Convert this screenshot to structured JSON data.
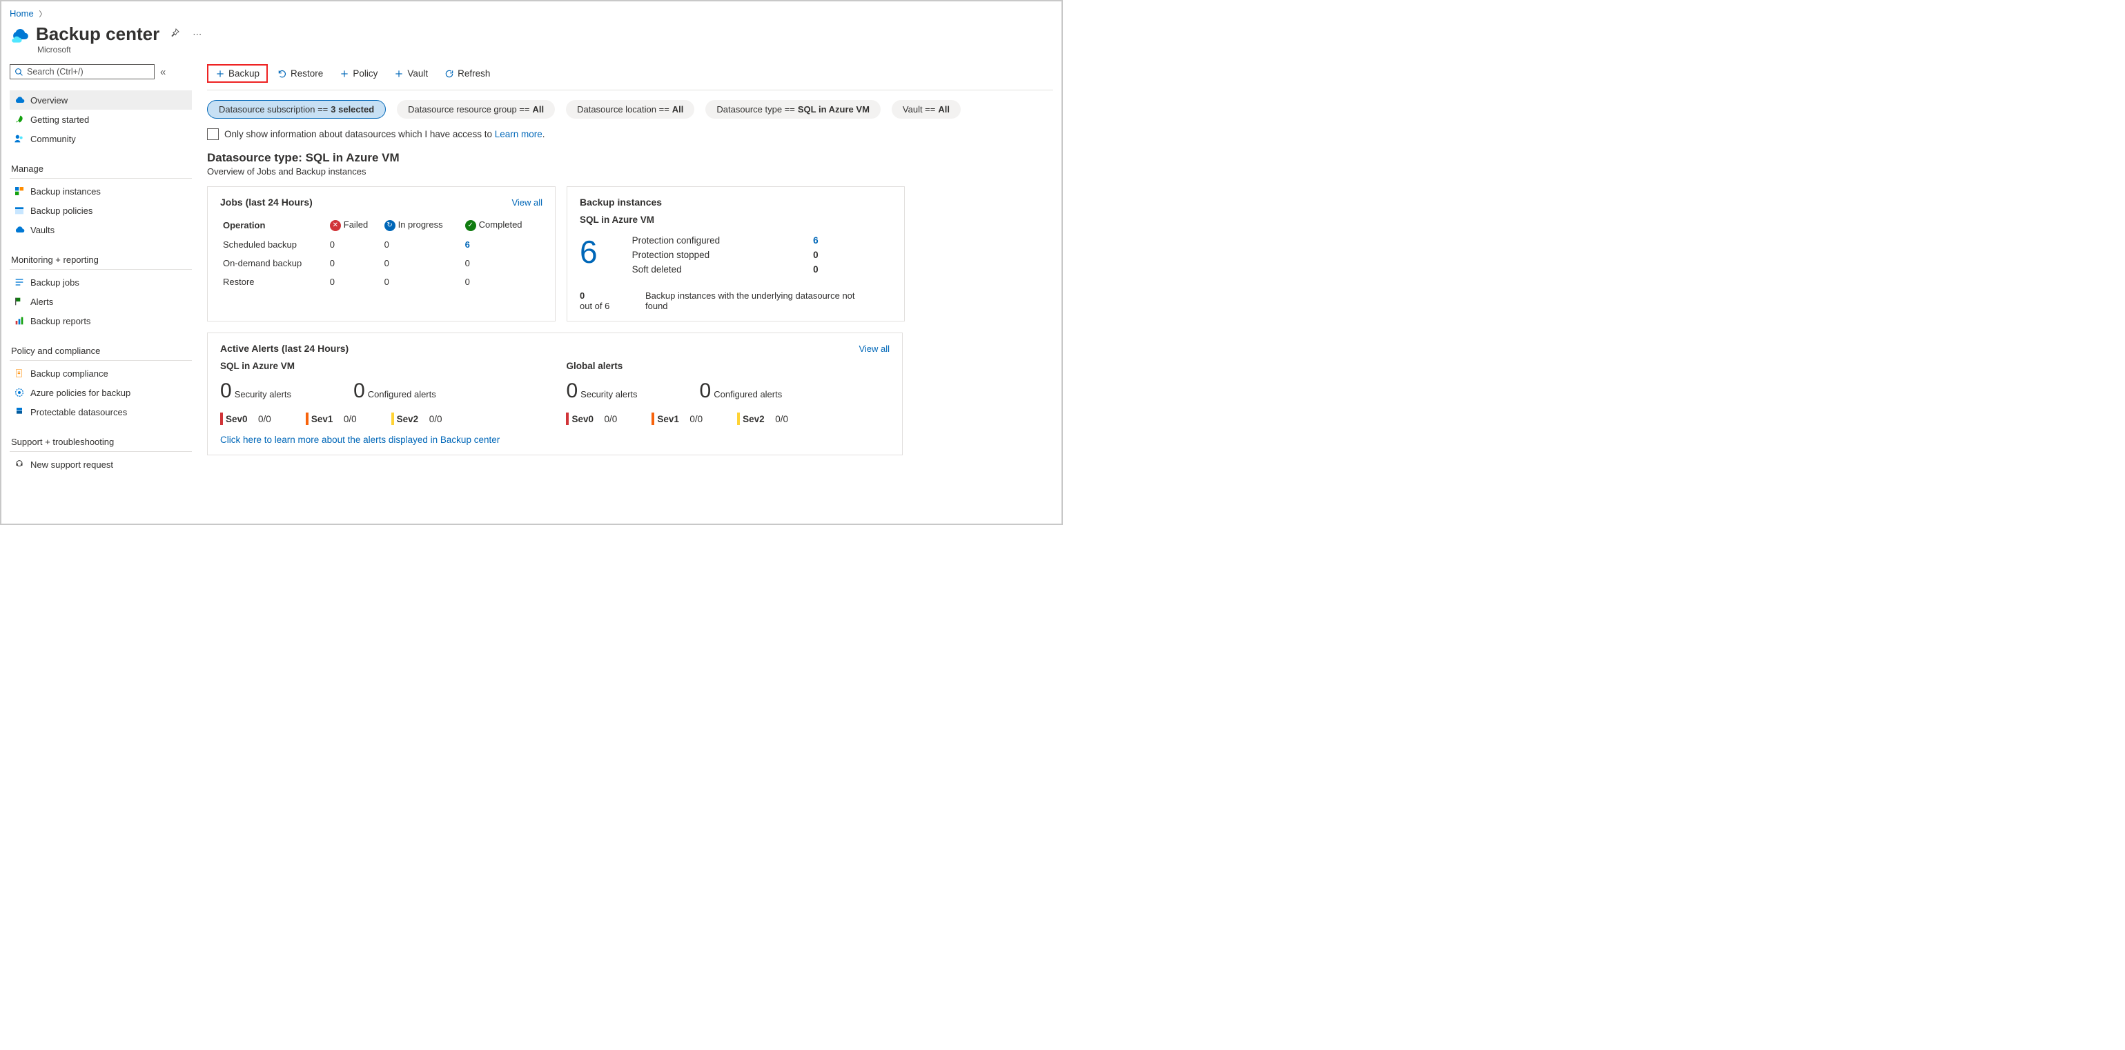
{
  "breadcrumb": {
    "home": "Home"
  },
  "header": {
    "title": "Backup center",
    "subtitle": "Microsoft"
  },
  "search": {
    "placeholder": "Search (Ctrl+/)"
  },
  "sidebar": {
    "s1": [
      {
        "label": "Overview"
      },
      {
        "label": "Getting started"
      },
      {
        "label": "Community"
      }
    ],
    "h2": "Manage",
    "s2": [
      {
        "label": "Backup instances"
      },
      {
        "label": "Backup policies"
      },
      {
        "label": "Vaults"
      }
    ],
    "h3": "Monitoring + reporting",
    "s3": [
      {
        "label": "Backup jobs"
      },
      {
        "label": "Alerts"
      },
      {
        "label": "Backup reports"
      }
    ],
    "h4": "Policy and compliance",
    "s4": [
      {
        "label": "Backup compliance"
      },
      {
        "label": "Azure policies for backup"
      },
      {
        "label": "Protectable datasources"
      }
    ],
    "h5": "Support + troubleshooting",
    "s5": [
      {
        "label": "New support request"
      }
    ]
  },
  "toolbar": {
    "backup": "Backup",
    "restore": "Restore",
    "policy": "Policy",
    "vault": "Vault",
    "refresh": "Refresh"
  },
  "pills": {
    "p1_label": "Datasource subscription == ",
    "p1_val": "3 selected",
    "p2_label": "Datasource resource group == ",
    "p2_val": "All",
    "p3_label": "Datasource location == ",
    "p3_val": "All",
    "p4_label": "Datasource type == ",
    "p4_val": "SQL in Azure VM",
    "p5_label": "Vault == ",
    "p5_val": "All"
  },
  "checkbox_row": {
    "label": "Only show information about datasources which I have access to ",
    "link": "Learn more"
  },
  "dstype": {
    "title": "Datasource type: SQL in Azure VM",
    "sub": "Overview of Jobs and Backup instances"
  },
  "jobs_card": {
    "title": "Jobs (last 24 Hours)",
    "viewall": "View all",
    "col_op": "Operation",
    "col_failed": "Failed",
    "col_prog": "In progress",
    "col_comp": "Completed",
    "r1": "Scheduled backup",
    "r1f": "0",
    "r1p": "0",
    "r1c": "6",
    "r2": "On-demand backup",
    "r2f": "0",
    "r2p": "0",
    "r2c": "0",
    "r3": "Restore",
    "r3f": "0",
    "r3p": "0",
    "r3c": "0"
  },
  "inst_card": {
    "title": "Backup instances",
    "sub": "SQL in Azure VM",
    "big": "6",
    "m1": "Protection configured",
    "v1": "6",
    "m2": "Protection stopped",
    "v2": "0",
    "m3": "Soft deleted",
    "v3": "0",
    "bot_n": "0",
    "bot_t": "out of 6",
    "bot_msg": "Backup instances with the underlying datasource not found"
  },
  "alerts_card": {
    "title": "Active Alerts (last 24 Hours)",
    "viewall": "View all",
    "sec1": "SQL in Azure VM",
    "sec2": "Global alerts",
    "security": "Security alerts",
    "configured": "Configured alerts",
    "zero": "0",
    "sev0": "Sev0",
    "sev1": "Sev1",
    "sev2": "Sev2",
    "cnt": "0/0",
    "link": "Click here to learn more about the alerts displayed in Backup center"
  }
}
